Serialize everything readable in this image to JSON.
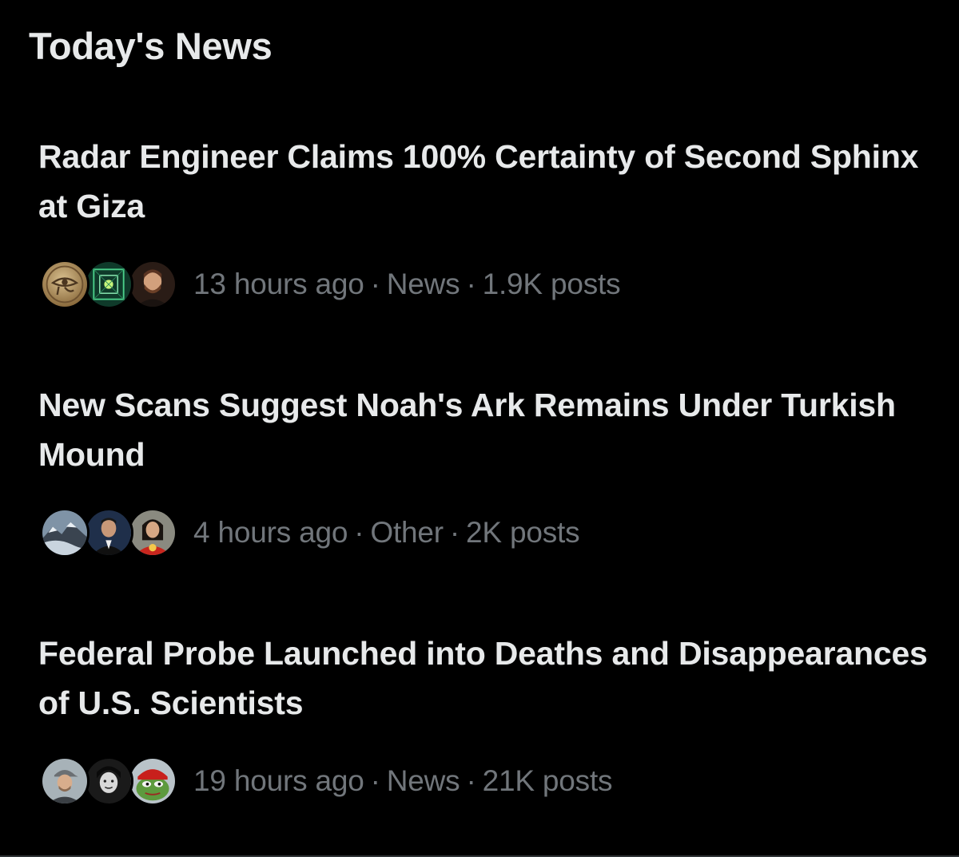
{
  "header": {
    "title": "Today's News"
  },
  "items": [
    {
      "headline": "Radar Engineer Claims 100% Certainty of Second Sphinx at Giza",
      "time": "13 hours ago",
      "category": "News",
      "posts": "1.9K posts",
      "separator": "·",
      "avatars": [
        "eye-of-horus-coin-avatar",
        "green-glyph-avatar",
        "bearded-man-avatar"
      ]
    },
    {
      "headline": "New Scans Suggest Noah's Ark Remains Under Turkish Mound",
      "time": "4 hours ago",
      "category": "Other",
      "posts": "2K posts",
      "separator": "·",
      "avatars": [
        "mountain-snow-avatar",
        "man-in-suit-avatar",
        "woman-red-shirt-avatar"
      ]
    },
    {
      "headline": "Federal Probe Launched into Deaths and Disappearances of U.S. Scientists",
      "time": "19 hours ago",
      "category": "News",
      "posts": "21K posts",
      "separator": "·",
      "avatars": [
        "man-cap-avatar",
        "sketched-face-avatar",
        "frog-red-hat-avatar"
      ]
    }
  ],
  "colors": {
    "background": "#000000",
    "headline": "#e7e9ea",
    "meta": "#71767b",
    "divider": "#2f3336"
  }
}
